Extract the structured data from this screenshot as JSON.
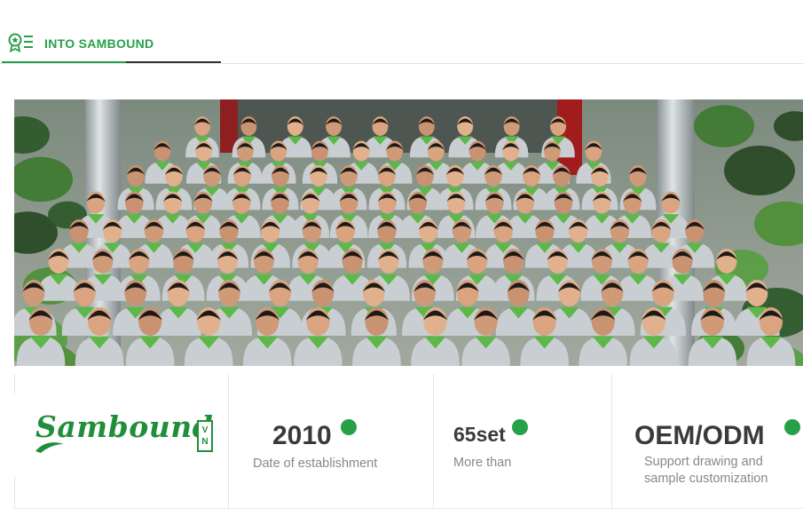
{
  "header": {
    "title": "INTO SAMBOUND",
    "icon": "award-list-icon",
    "accent_color": "#27a04a"
  },
  "photo": {
    "subject": "team-group-photo"
  },
  "logo": {
    "name": "Sambound",
    "badge": [
      "V",
      "N"
    ],
    "color": "#1f8f3a"
  },
  "stats": [
    {
      "value": "2010",
      "desc": [
        "Date of establishment"
      ]
    },
    {
      "value": "65set",
      "desc": [
        "More than"
      ]
    },
    {
      "value": "OEM/ODM",
      "desc": [
        "Support drawing and",
        "sample customization"
      ]
    }
  ]
}
